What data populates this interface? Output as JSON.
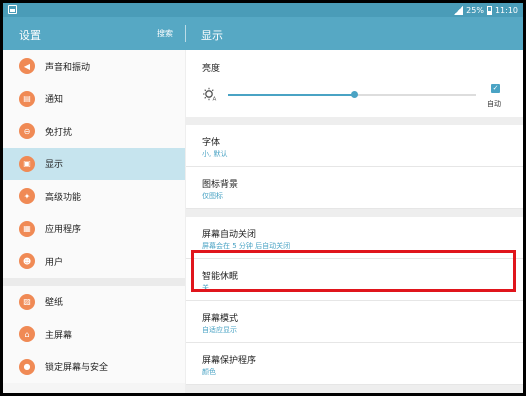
{
  "status_bar": {
    "battery": "25%",
    "time": "11:10"
  },
  "app_bar": {
    "left_title": "设置",
    "search_label": "搜索",
    "right_title": "显示"
  },
  "sidebar": {
    "group1": [
      {
        "label": "声音和振动",
        "icon": "volume-icon"
      },
      {
        "label": "通知",
        "icon": "notification-icon"
      },
      {
        "label": "免打扰",
        "icon": "do-not-disturb-icon"
      },
      {
        "label": "显示",
        "icon": "display-icon",
        "selected": true
      },
      {
        "label": "高级功能",
        "icon": "advanced-features-icon"
      },
      {
        "label": "应用程序",
        "icon": "apps-icon"
      },
      {
        "label": "用户",
        "icon": "users-icon"
      }
    ],
    "group2": [
      {
        "label": "壁纸",
        "icon": "wallpaper-icon"
      },
      {
        "label": "主屏幕",
        "icon": "home-icon"
      },
      {
        "label": "锁定屏幕与安全",
        "icon": "lock-icon"
      }
    ]
  },
  "display": {
    "brightness": {
      "title": "亮度",
      "level": 0.51,
      "auto_label": "自动",
      "auto_checked": true
    },
    "rows_a": [
      {
        "title": "字体",
        "sub": "小, 默认"
      },
      {
        "title": "图标背景",
        "sub": "仅图标"
      }
    ],
    "rows_b": [
      {
        "title": "屏幕自动关闭",
        "sub": "屏幕会在 5 分钟 后自动关闭"
      },
      {
        "title": "智能休眠",
        "sub": "关"
      },
      {
        "title": "屏幕模式",
        "sub": "自适应显示"
      },
      {
        "title": "屏幕保护程序",
        "sub": "颜色"
      }
    ]
  },
  "colors": {
    "accent": "#4aa3c4",
    "appbar": "#56a8c4",
    "icon_bg": "#f08a55",
    "highlight": "#e0151c"
  }
}
